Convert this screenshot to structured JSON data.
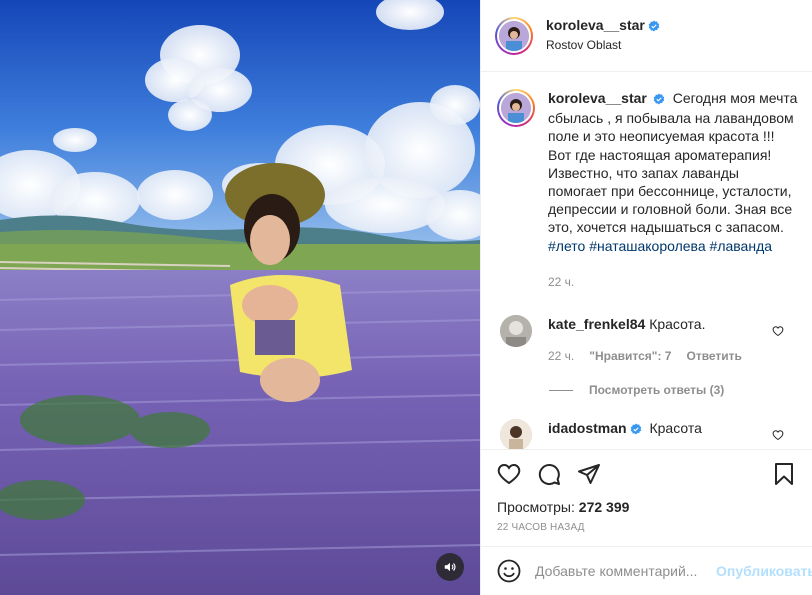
{
  "post": {
    "author": "koroleva__star",
    "location": "Rostov Oblast",
    "caption_text": "Сегодня моя мечта сбылась , я побывала на лавандовом поле и это неописуемая красота !!! Вот где настоящая ароматерапия! Известно, что запах лаванды помогает при бессоннице, усталости, депрессии и головной боли. Зная все это, хочется надышаться с запасом.",
    "hashtags": [
      "#лето",
      "#наташакоролева",
      "#лаванда"
    ],
    "caption_time": "22 ч.",
    "views_label": "Просмотры:",
    "views_count": "272 399",
    "posted_ago": "22 часов назад"
  },
  "comments": [
    {
      "user": "kate_frenkel84",
      "text": "Красота.⁣",
      "time": "22 ч.",
      "likes": "\"Нравится\": 7",
      "reply": "Ответить",
      "view_replies": "Посмотреть ответы (3)"
    },
    {
      "user": "idadostman",
      "verified": true,
      "text": "Красота"
    }
  ],
  "composer": {
    "placeholder": "Добавьте комментарий...",
    "publish": "Опубликовать"
  },
  "icons": {
    "verified": "verified-badge-icon",
    "like": "heart-icon",
    "comment": "comment-icon",
    "share": "paper-plane-icon",
    "save": "bookmark-icon",
    "emoji": "smiley-icon",
    "sound": "speaker-icon"
  },
  "colors": {
    "verified": "#3897f0",
    "hashtag": "#00376b",
    "muted": "#8e8e8e",
    "publish_disabled": "#b2dffc"
  }
}
